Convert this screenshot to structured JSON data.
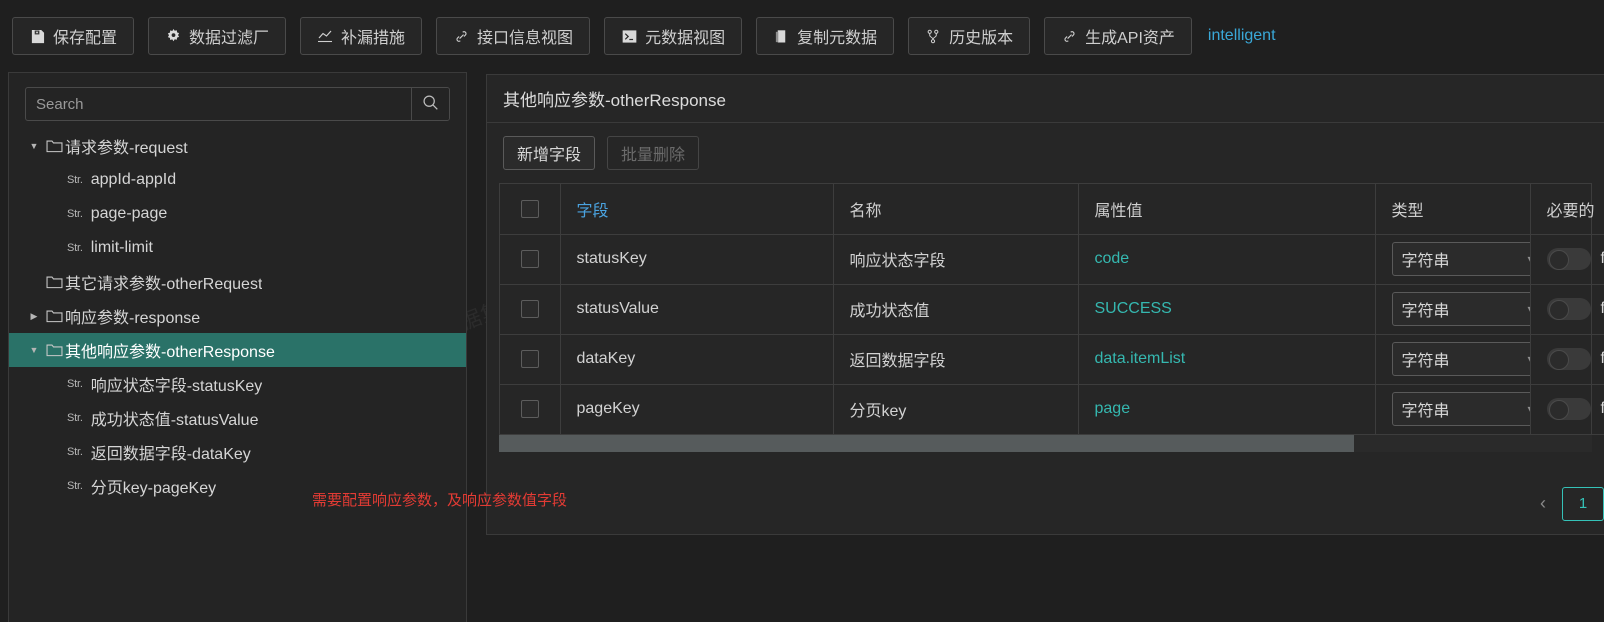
{
  "toolbar": {
    "buttons": [
      {
        "label": "保存配置",
        "icon": "save-icon"
      },
      {
        "label": "数据过滤厂",
        "icon": "gear-icon"
      },
      {
        "label": "补漏措施",
        "icon": "line-chart-icon"
      },
      {
        "label": "接口信息视图",
        "icon": "link-icon"
      },
      {
        "label": "元数据视图",
        "icon": "terminal-icon"
      },
      {
        "label": "复制元数据",
        "icon": "copy-icon"
      },
      {
        "label": "历史版本",
        "icon": "branch-icon"
      },
      {
        "label": "生成API资产",
        "icon": "link-icon"
      }
    ],
    "link_label": "intelligent",
    "link_color": "#3aa8d8"
  },
  "sidebar": {
    "search": {
      "value": "",
      "placeholder": "Search"
    },
    "search_icon": "search-icon",
    "tree": [
      {
        "label": "请求参数-request",
        "kind": "folder",
        "expand": "open",
        "depth": 0,
        "selected": false
      },
      {
        "label": "appId-appId",
        "kind": "leaf",
        "tag": "Str.",
        "depth": 1,
        "selected": false
      },
      {
        "label": "page-page",
        "kind": "leaf",
        "tag": "Str.",
        "depth": 1,
        "selected": false
      },
      {
        "label": "limit-limit",
        "kind": "leaf",
        "tag": "Str.",
        "depth": 1,
        "selected": false
      },
      {
        "label": "其它请求参数-otherRequest",
        "kind": "folder",
        "expand": "none",
        "depth": 0,
        "selected": false
      },
      {
        "label": "响应参数-response",
        "kind": "folder",
        "expand": "closed",
        "depth": 0,
        "selected": false
      },
      {
        "label": "其他响应参数-otherResponse",
        "kind": "folder",
        "expand": "open",
        "depth": 0,
        "selected": true
      },
      {
        "label": "响应状态字段-statusKey",
        "kind": "leaf",
        "tag": "Str.",
        "depth": 1,
        "selected": false
      },
      {
        "label": "成功状态值-statusValue",
        "kind": "leaf",
        "tag": "Str.",
        "depth": 1,
        "selected": false
      },
      {
        "label": "返回数据字段-dataKey",
        "kind": "leaf",
        "tag": "Str.",
        "depth": 1,
        "selected": false
      },
      {
        "label": "分页key-pageKey",
        "kind": "leaf",
        "tag": "Str.",
        "depth": 1,
        "selected": false
      }
    ],
    "selected_bg": "#2a7268"
  },
  "annotation": {
    "text": "需要配置响应参数，及响应参数值字段",
    "color": "#e33b34"
  },
  "main": {
    "title": "其他响应参数-otherResponse",
    "actions": {
      "add_label": "新增字段",
      "batch_delete_label": "批量删除"
    },
    "table": {
      "columns": [
        "字段",
        "名称",
        "属性值",
        "类型",
        "必要的"
      ],
      "sorted_column": "字段",
      "sorted_color": "#4aa3e0",
      "attr_color": "#35b8b0",
      "header_checkbox": false,
      "rows": [
        {
          "checked": false,
          "field": "statusKey",
          "name": "响应状态字段",
          "attr": "code",
          "type": "字符串",
          "required": "false",
          "required_on": false
        },
        {
          "checked": false,
          "field": "statusValue",
          "name": "成功状态值",
          "attr": "SUCCESS",
          "type": "字符串",
          "required": "false",
          "required_on": false
        },
        {
          "checked": false,
          "field": "dataKey",
          "name": "返回数据字段",
          "attr": "data.itemList",
          "type": "字符串",
          "required": "false",
          "required_on": false
        },
        {
          "checked": false,
          "field": "pageKey",
          "name": "分页key",
          "attr": "page",
          "type": "字符串",
          "required": "false",
          "required_on": false
        }
      ]
    },
    "pagination": {
      "prev_label": "‹",
      "current_page": "1",
      "accent": "#35c2b8"
    }
  },
  "watermark": {
    "text": "轻易云数据集成平台"
  }
}
